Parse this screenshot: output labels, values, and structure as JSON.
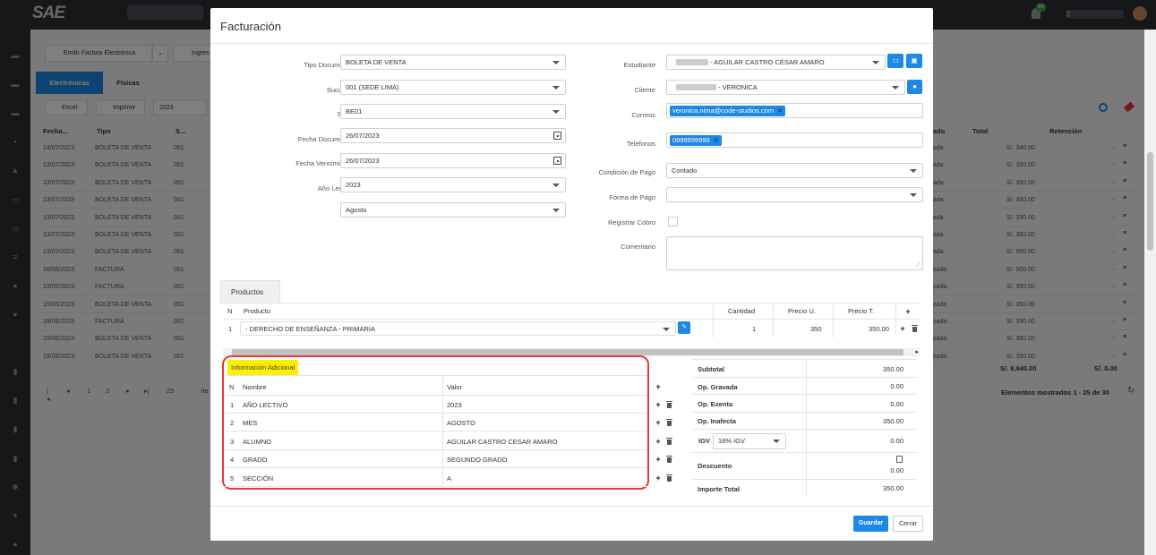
{
  "background": {
    "topbar": {
      "logo": "SAE",
      "notif_count": "20"
    },
    "toolbar": {
      "emit_label": "Emitir Factura Electrónica",
      "ingreso_label": "Ingres",
      "excel_label": "Excel",
      "print_label": "Imprimir",
      "year_value": "2023"
    },
    "tabs": [
      "Electrónicas",
      "Físicas"
    ],
    "columns": {
      "fecha": "Fecha...",
      "tipo": "Tipo",
      "serie": "S...",
      "estado": "ado",
      "total": "Total",
      "retencion": "Retención"
    },
    "rows": [
      {
        "fecha": "14/07/2023",
        "tipo": "BOLETA DE VENTA",
        "serie": "001",
        "estado": "ada",
        "total": "S/. 340.00",
        "retencion": "-"
      },
      {
        "fecha": "13/07/2023",
        "tipo": "BOLETA DE VENTA",
        "serie": "001",
        "estado": "ada",
        "total": "S/. 350.00",
        "retencion": "-"
      },
      {
        "fecha": "13/07/2023",
        "tipo": "BOLETA DE VENTA",
        "serie": "001",
        "estado": "ada",
        "total": "S/. 350.00",
        "retencion": "-"
      },
      {
        "fecha": "13/07/2023",
        "tipo": "BOLETA DE VENTA",
        "serie": "001",
        "estado": "ada",
        "total": "S/. 350.00",
        "retencion": "-"
      },
      {
        "fecha": "13/07/2023",
        "tipo": "BOLETA DE VENTA",
        "serie": "001",
        "estado": "ada",
        "total": "S/. 350.00",
        "retencion": "-"
      },
      {
        "fecha": "13/07/2023",
        "tipo": "BOLETA DE VENTA",
        "serie": "001",
        "estado": "ada",
        "total": "S/. 350.00",
        "retencion": "-"
      },
      {
        "fecha": "13/07/2023",
        "tipo": "BOLETA DE VENTA",
        "serie": "001",
        "estado": "ada",
        "total": "S/. 500.00",
        "retencion": "-"
      },
      {
        "fecha": "16/06/2023",
        "tipo": "FACTURA",
        "serie": "001",
        "estado": "zada",
        "total": "S/. 500.00",
        "retencion": "-"
      },
      {
        "fecha": "19/05/2023",
        "tipo": "FACTURA",
        "serie": "001",
        "estado": "zada",
        "total": "S/. 350.00",
        "retencion": "-"
      },
      {
        "fecha": "19/05/2023",
        "tipo": "BOLETA DE VENTA",
        "serie": "001",
        "estado": "zada",
        "total": "S/. 350.00",
        "retencion": "-"
      },
      {
        "fecha": "19/05/2023",
        "tipo": "FACTURA",
        "serie": "001",
        "estado": "zada",
        "total": "S/. 350.00",
        "retencion": "-"
      },
      {
        "fecha": "19/05/2023",
        "tipo": "BOLETA DE VENTA",
        "serie": "001",
        "estado": "zada",
        "total": "S/. 350.00",
        "retencion": "-"
      },
      {
        "fecha": "19/05/2023",
        "tipo": "BOLETA DE VENTA",
        "serie": "001",
        "estado": "zada",
        "total": "S/. 350.00",
        "retencion": "-"
      }
    ],
    "sum_total": "S/. 8,940.00",
    "sum_retencion": "S/. 0.00",
    "pager": {
      "pages": [
        "1",
        "2"
      ],
      "page_size": "25",
      "items_label": "ite",
      "shown": "Elementos mostrados 1 - 25 de 30"
    }
  },
  "modal": {
    "title": "Facturación",
    "left_fields": [
      {
        "label": "Tipo Documento",
        "value": "BOLETA DE VENTA"
      },
      {
        "label": "Sucursal",
        "value": "001 (SEDE LIMA)"
      },
      {
        "label": "Serie",
        "value": "BE01"
      },
      {
        "label": "Fecha Documento",
        "value": "26/07/2023"
      },
      {
        "label": "Fecha Vencimiento",
        "value": "26/07/2023"
      },
      {
        "label": "Año Lectivo",
        "value": "2023"
      },
      {
        "label": "Mes",
        "value": "Agosto"
      }
    ],
    "right_fields": {
      "estudiante_label": "Estudiante",
      "estudiante_value": "- AGUILAR CASTRO CÉSAR AMARO",
      "cliente_label": "Cliente",
      "cliente_value": "- VERONICA",
      "correos_label": "Correos",
      "correo_tag": "veronica.nima@code-studios.com",
      "telefonos_label": "Teléfonos",
      "telefono_tag": "0999999999",
      "condicion_label": "Condición de Pago",
      "condicion_value": "Contado",
      "forma_label": "Forma de Pago",
      "forma_value": "",
      "registrar_label": "Registrar Cobro",
      "comentario_label": "Comentario",
      "comentario_value": ""
    },
    "products_tab": "Productos",
    "products_headers": {
      "n": "N",
      "producto": "Producto",
      "cantidad": "Cantidad",
      "precio_u": "Precio U.",
      "precio_t": "Precio T."
    },
    "product_row": {
      "n": "1",
      "producto": "- DERECHO DE ENSEÑANZA - PRIMARIA",
      "cantidad": "1",
      "precio_u": "350",
      "precio_t": "350.00"
    },
    "info": {
      "title": "Información Adicional",
      "headers": {
        "n": "N",
        "nombre": "Nombre",
        "valor": "Valor"
      },
      "rows": [
        {
          "n": "1",
          "nombre": "AÑO LECTIVO",
          "valor": "2023"
        },
        {
          "n": "2",
          "nombre": "MES",
          "valor": "AGOSTO"
        },
        {
          "n": "3",
          "nombre": "ALUMNO",
          "valor": "AGUILAR CASTRO CESAR AMARO"
        },
        {
          "n": "4",
          "nombre": "GRADO",
          "valor": "SEGUNDO GRADO"
        },
        {
          "n": "5",
          "nombre": "SECCIÓN",
          "valor": "A"
        }
      ]
    },
    "totals": {
      "subtotal_label": "Subtotal",
      "subtotal": "350.00",
      "gravada_label": "Op. Gravada",
      "gravada": "0.00",
      "exenta_label": "Op. Exenta",
      "exenta": "0.00",
      "inafecta_label": "Op. Inafecta",
      "inafecta": "350.00",
      "igv_label": "IGV",
      "igv_select": "18% IGV",
      "igv": "0.00",
      "descuento_label": "Descuento",
      "descuento": "0.00",
      "importe_label": "Importe Total",
      "importe": "350.00"
    },
    "buttons": {
      "save": "Guardar",
      "close": "Cerrar"
    }
  }
}
